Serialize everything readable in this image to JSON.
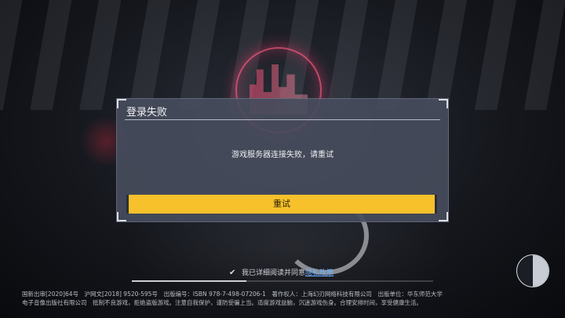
{
  "dialog": {
    "title": "登录失败",
    "message": "游戏服务器连接失败，请重试",
    "retry_label": "重试"
  },
  "agreement": {
    "text": "我已详细阅读并同意",
    "link": "隐私政策",
    "checked": true
  },
  "loading": {
    "progress": 0.38
  },
  "footer": {
    "line1": "国新出审[2020]64号　沪网文[2018] 9520-595号　出版编号：ISBN 978-7-498-07206-1　著作权人：上海幻刃网络科技有限公司　出版单位：华东师范大学",
    "line2": "电子音像出版社有限公司　抵制不良游戏，拒绝盗版游戏。注意自我保护，谨防受骗上当。适度游戏益脑，沉迷游戏伤身。合理安排时间，享受健康生活。"
  },
  "colors": {
    "accent": "#f6c12a",
    "link": "#6fb3ff",
    "dialog_bg": "#464c5c"
  },
  "icons": {
    "check": "check-icon",
    "corner_widget": "half-moon-icon"
  }
}
